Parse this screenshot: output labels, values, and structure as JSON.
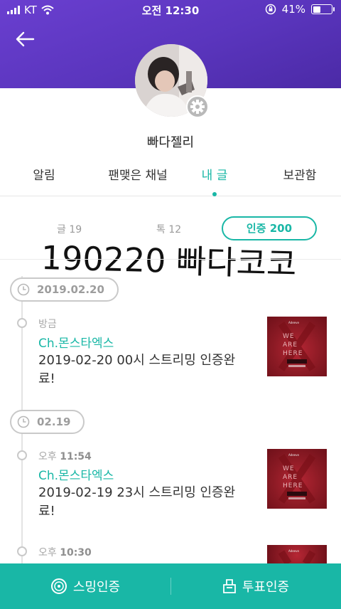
{
  "status": {
    "carrier": "KT",
    "time": "오전 12:30",
    "battery": "41%",
    "battery_level": 0.41
  },
  "profile": {
    "nickname": "빠다젤리"
  },
  "tabs": [
    {
      "label": "알림"
    },
    {
      "label": "팬맺은 채널"
    },
    {
      "label": "내 글"
    },
    {
      "label": "보관함"
    }
  ],
  "stats": {
    "posts": "글 19",
    "talks": "톡 12",
    "cert_button": "인증 200"
  },
  "overlay": {
    "text": "190220 빠다코코"
  },
  "timeline": {
    "groups": [
      {
        "date": "2019.02.20",
        "items": [
          {
            "time_prefix": "방금",
            "time_value": "",
            "channel": "Ch.몬스타엑스",
            "text": "2019-02-20 00시 스트리밍 인증완료!"
          }
        ]
      },
      {
        "date": "02.19",
        "items": [
          {
            "time_prefix": "오후",
            "time_value": "11:54",
            "channel": "Ch.몬스타엑스",
            "text": "2019-02-19 23시 스트리밍 인증완료!"
          },
          {
            "time_prefix": "오후",
            "time_value": "10:30",
            "channel": "",
            "text": ""
          }
        ]
      }
    ]
  },
  "bottom": {
    "stream_label": "스밍인증",
    "vote_label": "투표인증"
  },
  "colors": {
    "accent": "#19b7a6",
    "header": "#5a35bd"
  }
}
